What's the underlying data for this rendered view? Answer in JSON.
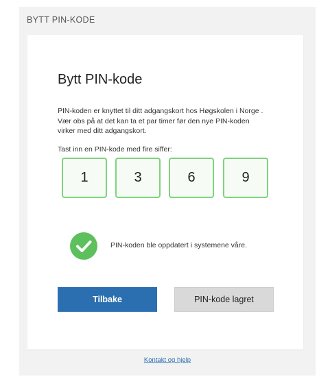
{
  "header": {
    "title": "BYTT PIN-KODE"
  },
  "card": {
    "title": "Bytt PIN-kode",
    "description": "PIN-koden er knyttet til ditt adgangskort hos Høgskolen i Norge . Vær obs på at det kan ta et par timer før den nye PIN-koden virker med ditt adgangskort.",
    "pin_label": "Tast inn en PIN-kode med fire siffer:",
    "pin_digits": [
      "1",
      "3",
      "6",
      "9"
    ],
    "success_message": "PIN-koden ble oppdatert i systemene våre.",
    "success_icon": "check-circle-icon",
    "back_button": "Tilbake",
    "saved_button": "PIN-kode lagret"
  },
  "footer": {
    "link": "Kontakt og hjelp"
  },
  "colors": {
    "primary_button": "#2c6fb0",
    "success_green": "#5cc05c",
    "pin_border": "#7ed37e"
  }
}
